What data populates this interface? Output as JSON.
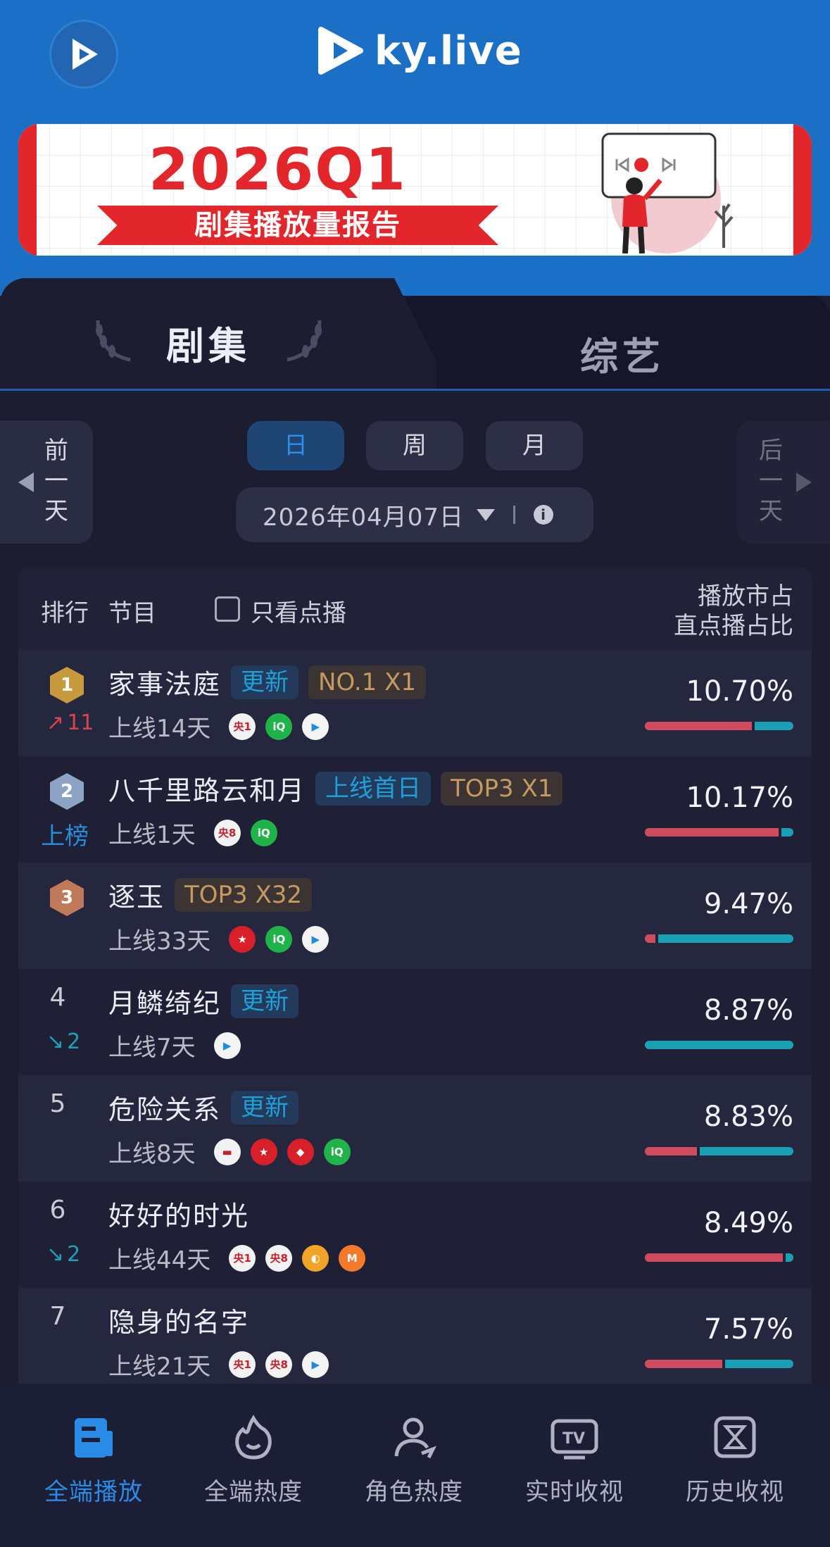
{
  "header": {
    "brand": "ky.live"
  },
  "banner": {
    "title": "2026Q1",
    "subtitle": "剧集播放量报告"
  },
  "tabs": [
    {
      "label": "剧集",
      "active": true
    },
    {
      "label": "综艺",
      "active": false
    }
  ],
  "date_nav": {
    "prev_label": "前一天",
    "next_label": "后一天",
    "periods": [
      {
        "label": "日",
        "active": true
      },
      {
        "label": "周",
        "active": false
      },
      {
        "label": "月",
        "active": false
      }
    ],
    "date": "2026年04月07日"
  },
  "list_header": {
    "rank": "排行",
    "program": "节目",
    "filter_label": "只看点播",
    "metric_line1": "播放市占",
    "metric_line2": "直点播占比"
  },
  "rows": [
    {
      "rank": "1",
      "change": "11",
      "change_type": "up",
      "name": "家事法庭",
      "tags": [
        "更新",
        "NO.1 X1"
      ],
      "online": "上线14天",
      "platforms": [
        "央1",
        "iQIYI",
        "Tencent"
      ],
      "share": "10.70%",
      "live_ratio": 0.72
    },
    {
      "rank": "2",
      "change": "上榜",
      "change_type": "new",
      "name": "八千里路云和月",
      "tags": [
        "上线首日",
        "TOP3 X1"
      ],
      "online": "上线1天",
      "platforms": [
        "央8",
        "iQIYI"
      ],
      "share": "10.17%",
      "live_ratio": 0.9
    },
    {
      "rank": "3",
      "change": "",
      "change_type": "none",
      "name": "逐玉",
      "tags": [
        "TOP3 X32"
      ],
      "online": "上线33天",
      "platforms": [
        "Dragon",
        "iQIYI",
        "Tencent"
      ],
      "share": "9.47%",
      "live_ratio": 0.07
    },
    {
      "rank": "4",
      "change": "2",
      "change_type": "down",
      "name": "月鳞绮纪",
      "tags": [
        "更新"
      ],
      "online": "上线7天",
      "platforms": [
        "Youku"
      ],
      "share": "8.87%",
      "live_ratio": 0.0
    },
    {
      "rank": "5",
      "change": "",
      "change_type": "none",
      "name": "危险关系",
      "tags": [
        "更新"
      ],
      "online": "上线8天",
      "platforms": [
        "BTV",
        "Dragon",
        "Jiangsu",
        "iQIYI"
      ],
      "share": "8.83%",
      "live_ratio": 0.35
    },
    {
      "rank": "6",
      "change": "2",
      "change_type": "down",
      "name": "好好的时光",
      "tags": [],
      "online": "上线44天",
      "platforms": [
        "央1",
        "央8",
        "Hunan",
        "Mango"
      ],
      "share": "8.49%",
      "live_ratio": 0.93
    },
    {
      "rank": "7",
      "change": "",
      "change_type": "none",
      "name": "隐身的名字",
      "tags": [],
      "online": "上线21天",
      "platforms": [
        "央1",
        "央8",
        "Tencent"
      ],
      "share": "7.57%",
      "live_ratio": 0.52
    }
  ],
  "bottom_nav": [
    {
      "label": "全端播放",
      "icon": "document-icon",
      "active": true
    },
    {
      "label": "全端热度",
      "icon": "flame-icon",
      "active": false
    },
    {
      "label": "角色热度",
      "icon": "person-icon",
      "active": false
    },
    {
      "label": "实时收视",
      "icon": "tv-icon",
      "active": false
    },
    {
      "label": "历史收视",
      "icon": "hourglass-icon",
      "active": false
    }
  ],
  "colors": {
    "accent": "#2a8be6",
    "live": "#d14b5e",
    "vod": "#1aa0b4",
    "tag_blue": "#1fa0d8",
    "tag_gold": "#c49a62"
  }
}
